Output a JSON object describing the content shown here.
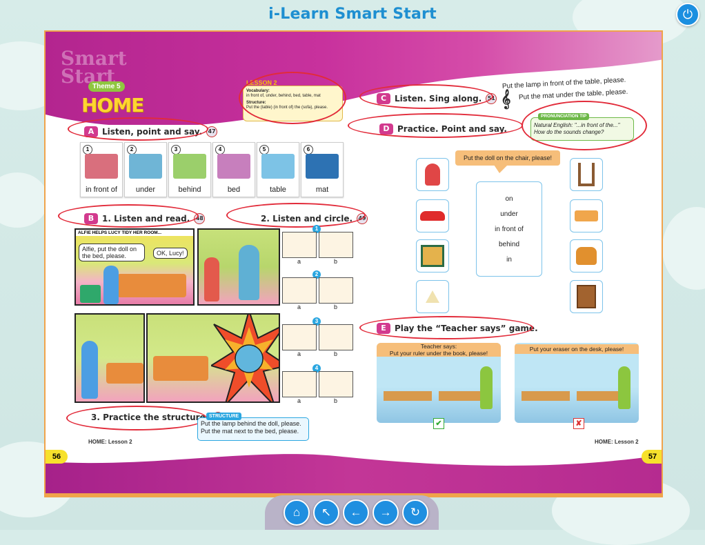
{
  "app": {
    "title": "i-Learn Smart Start",
    "power_icon": "⏻"
  },
  "header": {
    "theme_label": "Theme 5",
    "theme_title": "HOME",
    "watermark": "Smart Start"
  },
  "lesson_box": {
    "tag": "LESSON 2",
    "vocab_label": "Vocabulary:",
    "vocab_text": "in front of, under, behind, bed, table, mat",
    "structure_label": "Structure:",
    "structure_text": "Put the (table) (in front of) the (sofa), please."
  },
  "section_a": {
    "letter": "A",
    "title": "Listen, point and say.",
    "audio": "47",
    "cards": [
      {
        "num": "1",
        "label": "in front of",
        "color": "#d96f7d"
      },
      {
        "num": "2",
        "label": "under",
        "color": "#6fb5d6"
      },
      {
        "num": "3",
        "label": "behind",
        "color": "#9bcf6b"
      },
      {
        "num": "4",
        "label": "bed",
        "color": "#c77fbd"
      },
      {
        "num": "5",
        "label": "table",
        "color": "#7dc3e6"
      },
      {
        "num": "6",
        "label": "mat",
        "color": "#2d72b3"
      }
    ]
  },
  "section_b": {
    "letter": "B",
    "title": "1. Listen and read.",
    "audio": "48",
    "comic_title": "ALFIE HELPS LUCY TIDY HER ROOM...",
    "bubble_1": "Alfie, put the doll on the bed, please.",
    "bubble_2": "OK, Lucy!"
  },
  "listen_circle": {
    "title": "2. Listen and circle.",
    "audio": "49",
    "rows": [
      {
        "num": "1",
        "a": "a",
        "b": "b"
      },
      {
        "num": "2",
        "a": "a",
        "b": "b"
      },
      {
        "num": "3",
        "a": "a",
        "b": "b"
      },
      {
        "num": "4",
        "a": "a",
        "b": "b"
      }
    ]
  },
  "practice_structure": {
    "title": "3. Practice the structure.",
    "audio": "50",
    "box_label": "STRUCTURE",
    "line_1": "Put the lamp behind the doll, please.",
    "line_2": "Put the mat next to the bed, please."
  },
  "footer": {
    "left_label": "HOME: Lesson 2",
    "right_label": "HOME: Lesson 2",
    "left_page": "56",
    "right_page": "57"
  },
  "section_c": {
    "letter": "C",
    "title": "Listen. Sing along.",
    "audio": "51",
    "lyric_1": "Put the lamp in front of the table, please.",
    "lyric_2": "Put the mat under the table, please."
  },
  "pron_tip": {
    "label": "PRONUNCIATION TIP",
    "line_1": "Natural English: \"...in front of the...\"",
    "line_2": "How do the sounds change?"
  },
  "section_d": {
    "letter": "D",
    "title": "Practice. Point and say.",
    "speech": "Put the doll on the chair, please!",
    "prepositions": [
      "on",
      "under",
      "in front of",
      "behind",
      "in"
    ]
  },
  "section_e": {
    "letter": "E",
    "title": "Play the “Teacher says” game.",
    "left_caption_1": "Teacher says:",
    "left_caption_2": "Put your ruler under the book, please!",
    "right_caption": "Put your eraser on the desk, please!",
    "check": "✔",
    "cross": "✘"
  },
  "nav": {
    "home": "⌂",
    "up": "↖",
    "prev": "←",
    "next": "→",
    "refresh": "↻"
  }
}
